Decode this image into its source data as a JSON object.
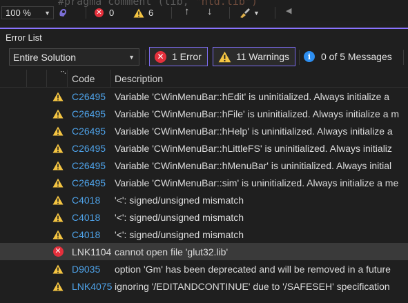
{
  "editor": {
    "code_fragment_a": "#pragma comment (lib, ",
    "code_fragment_b": "\"ntd.lib\")"
  },
  "status_bar": {
    "zoom": "100 %",
    "error_count": "0",
    "warning_count": "6"
  },
  "panel": {
    "title": "Error List",
    "scope": "Entire Solution",
    "errors_filter": "1 Error",
    "warnings_filter": "11 Warnings",
    "messages_filter": "0 of 5 Messages"
  },
  "columns": {
    "code": "Code",
    "description": "Description"
  },
  "rows": [
    {
      "severity": "warning",
      "code": "C26495",
      "link": true,
      "description": "Variable 'CWinMenuBar::hEdit' is uninitialized. Always initialize a"
    },
    {
      "severity": "warning",
      "code": "C26495",
      "link": true,
      "description": "Variable 'CWinMenuBar::hFile' is uninitialized. Always initialize a m"
    },
    {
      "severity": "warning",
      "code": "C26495",
      "link": true,
      "description": "Variable 'CWinMenuBar::hHelp' is uninitialized. Always initialize a"
    },
    {
      "severity": "warning",
      "code": "C26495",
      "link": true,
      "description": "Variable 'CWinMenuBar::hLittleFS' is uninitialized. Always initializ"
    },
    {
      "severity": "warning",
      "code": "C26495",
      "link": true,
      "description": "Variable 'CWinMenuBar::hMenuBar' is uninitialized. Always initial"
    },
    {
      "severity": "warning",
      "code": "C26495",
      "link": true,
      "description": "Variable 'CWinMenuBar::sim' is uninitialized. Always initialize a me"
    },
    {
      "severity": "warning",
      "code": "C4018",
      "link": true,
      "description": "'<': signed/unsigned mismatch"
    },
    {
      "severity": "warning",
      "code": "C4018",
      "link": true,
      "description": "'<': signed/unsigned mismatch"
    },
    {
      "severity": "warning",
      "code": "C4018",
      "link": true,
      "description": "'<': signed/unsigned mismatch"
    },
    {
      "severity": "error",
      "code": "LNK1104",
      "link": false,
      "description": "cannot open file 'glut32.lib'"
    },
    {
      "severity": "warning",
      "code": "D9035",
      "link": true,
      "description": "option 'Gm' has been deprecated and will be removed in a future"
    },
    {
      "severity": "warning",
      "code": "LNK4075",
      "link": true,
      "description": "ignoring '/EDITANDCONTINUE' due to '/SAFESEH' specification"
    }
  ],
  "selected_row": 9,
  "colors": {
    "accent": "#8a73ff",
    "error": "#e5303c",
    "warning": "#f5c542",
    "info": "#2d8ef0",
    "link": "#4ea2e8"
  }
}
